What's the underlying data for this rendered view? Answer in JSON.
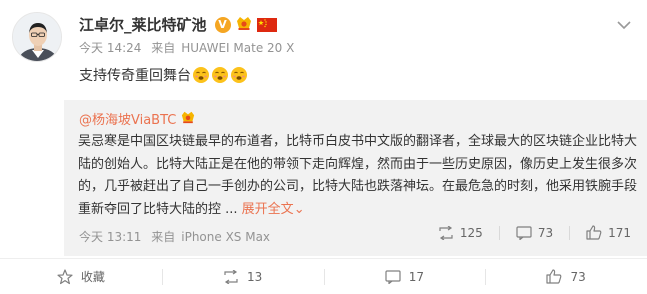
{
  "post": {
    "author": "江卓尔_莱比特矿池",
    "verified_badge_letter": "V",
    "meta_time": "今天 14:24",
    "meta_source_prefix": "来自",
    "meta_source": "HUAWEI Mate 20 X",
    "content": "支持传奇重回舞台",
    "emoji_count": 3
  },
  "repost": {
    "username": "@杨海坡ViaBTC",
    "text": "吴忌寒是中国区块链最早的布道者，比特币白皮书中文版的翻译者，全球最大的区块链企业比特大陆的创始人。比特大陆正是在他的带领下走向辉煌，然而由于一些历史原因，像历史上发生很多次的，几乎被赶出了自己一手创办的公司，比特大陆也跌落神坛。在最危急的时刻，他采用铁腕手段重新夺回了比特大陆的控 ...",
    "more_label": "展开全文",
    "more_arrow": "⌄",
    "meta_time": "今天 13:11",
    "meta_source_prefix": "来自",
    "meta_source": "iPhone XS Max",
    "actions": {
      "repost_count": "125",
      "comment_count": "73",
      "like_count": "171"
    }
  },
  "footer": {
    "favorite_label": "收藏",
    "repost_count": "13",
    "comment_count": "17",
    "like_count": "73"
  },
  "colors": {
    "link": "#eb7350",
    "muted": "#939393",
    "badge": "#f5a623",
    "repost_bg": "#f2f2f2"
  },
  "icons": {
    "chevron": "chevron-down-icon",
    "star": "star-icon",
    "repost": "repost-icon",
    "comment": "comment-icon",
    "like": "thumbs-up-icon",
    "flag": "china-flag-icon",
    "crown": "lucky-badge-icon"
  }
}
